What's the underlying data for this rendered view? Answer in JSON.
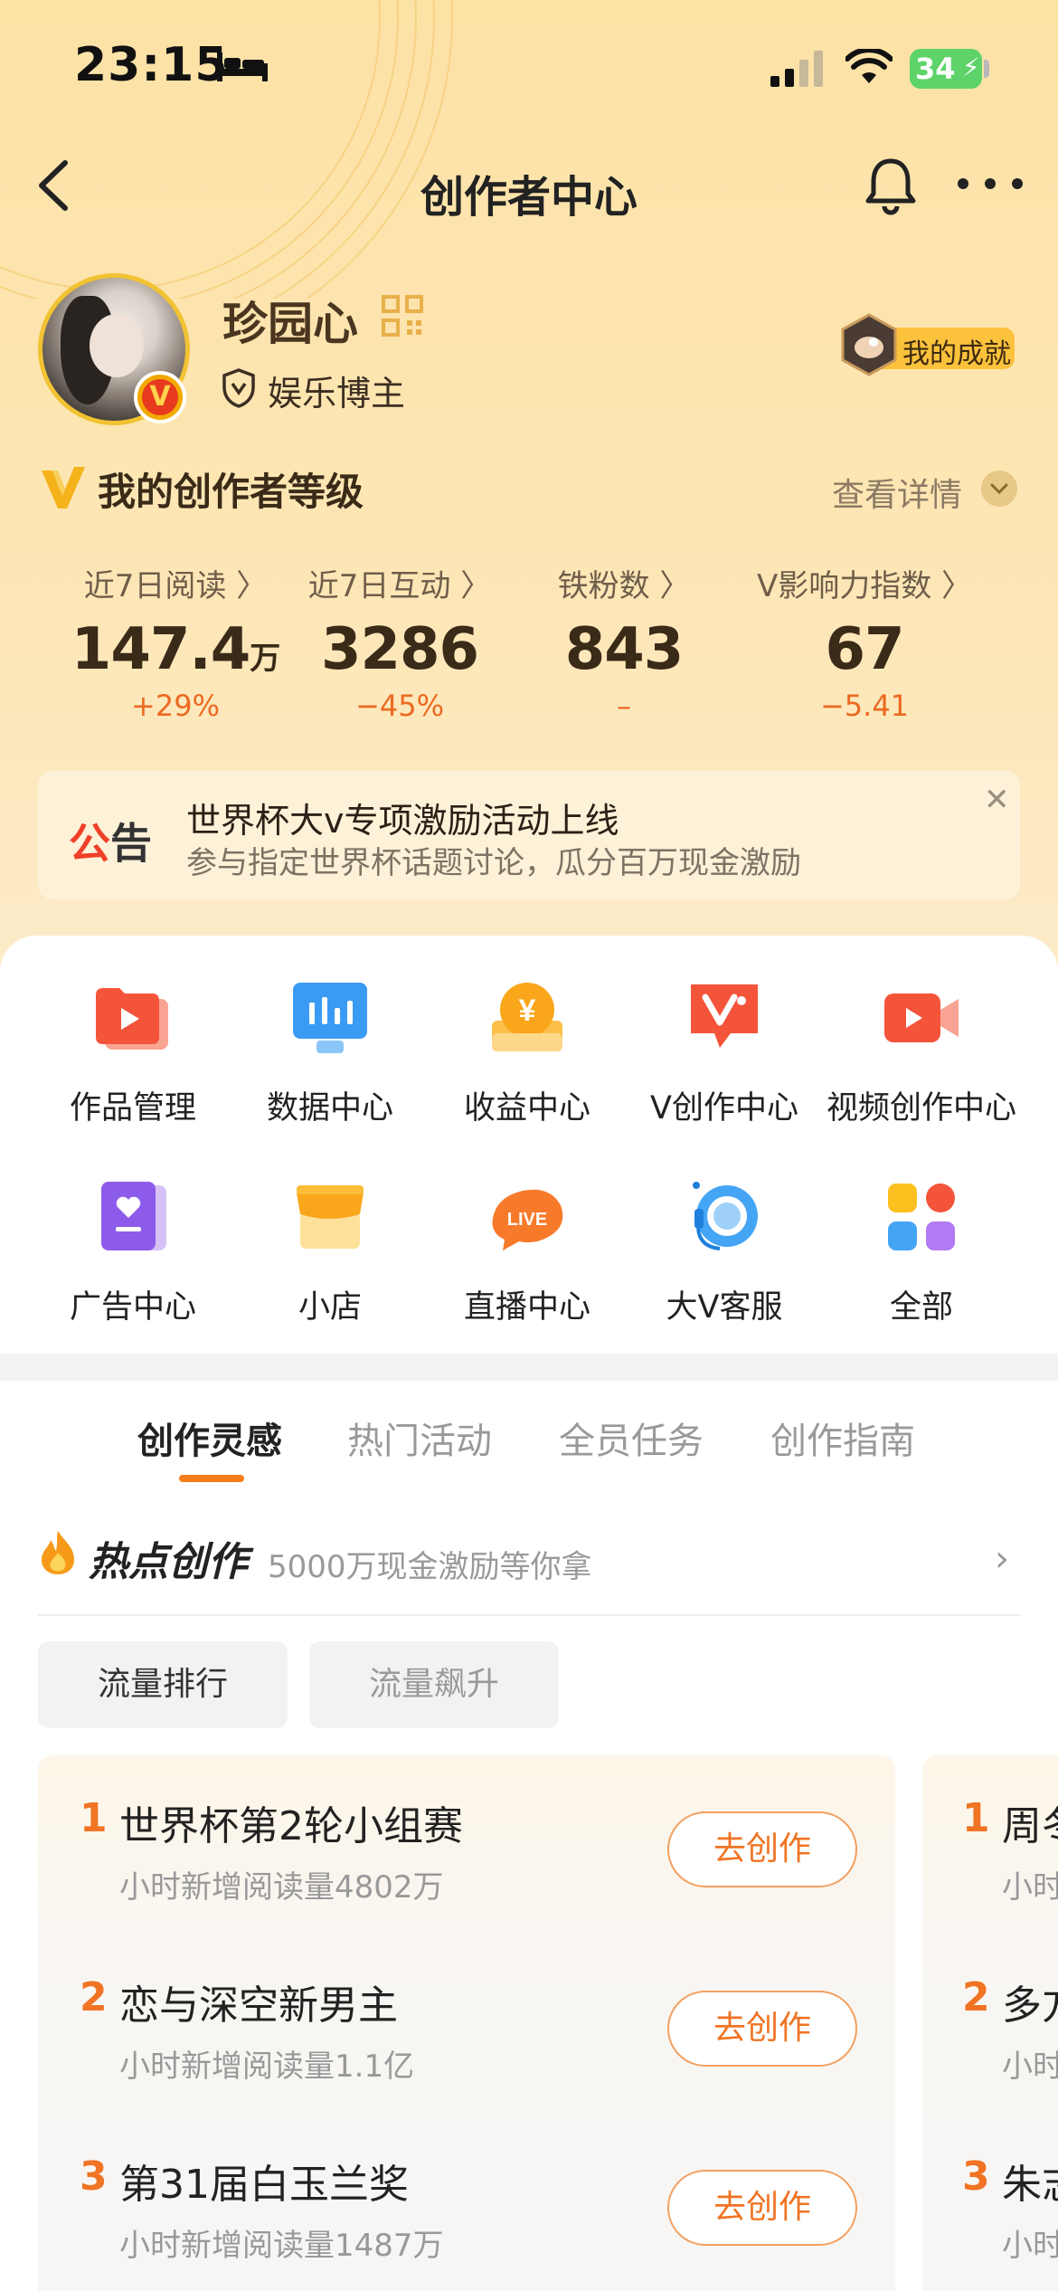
{
  "status_bar": {
    "time": "23:15",
    "battery": "34"
  },
  "nav": {
    "title": "创作者中心"
  },
  "profile": {
    "name": "珍园心",
    "role": "娱乐博主",
    "verified_badge": "V",
    "achievement": "我的成就"
  },
  "level": {
    "title": "我的创作者等级",
    "detail": "查看详情"
  },
  "stats": [
    {
      "label": "近7日阅读 〉",
      "value": "147.4",
      "unit": "万",
      "change": "+29%"
    },
    {
      "label": "近7日互动 〉",
      "value": "3286",
      "unit": "",
      "change": "−45%"
    },
    {
      "label": "铁粉数 〉",
      "value": "843",
      "unit": "",
      "change": "–"
    },
    {
      "label": "V影响力指数 〉",
      "value": "67",
      "unit": "",
      "change": "−5.41"
    }
  ],
  "notice": {
    "tag_a": "公",
    "tag_b": "告",
    "line1": "世界杯大v专项激励活动上线",
    "line2": "参与指定世界杯话题讨论，瓜分百万现金激励"
  },
  "grid": [
    {
      "label": "作品管理",
      "icon": "works-folder-icon"
    },
    {
      "label": "数据中心",
      "icon": "data-chart-icon"
    },
    {
      "label": "收益中心",
      "icon": "yen-coin-icon"
    },
    {
      "label": "V创作中心",
      "icon": "v-create-icon"
    },
    {
      "label": "视频创作中心",
      "icon": "video-camera-icon"
    },
    {
      "label": "广告中心",
      "icon": "ad-book-icon"
    },
    {
      "label": "小店",
      "icon": "shop-icon"
    },
    {
      "label": "直播中心",
      "icon": "live-icon"
    },
    {
      "label": "大V客服",
      "icon": "headset-service-icon"
    },
    {
      "label": "全部",
      "icon": "all-apps-icon"
    }
  ],
  "tabs": [
    "创作灵感",
    "热门活动",
    "全员任务",
    "创作指南"
  ],
  "hot": {
    "title": "热点创作",
    "subtitle": "5000万现金激励等你拿"
  },
  "chips": [
    "流量排行",
    "流量飙升"
  ],
  "rank": [
    {
      "num": "1",
      "title": "世界杯第2轮小组赛",
      "sub": "小时新增阅读量4802万",
      "button": "去创作"
    },
    {
      "num": "2",
      "title": "恋与深空新男主",
      "sub": "小时新增阅读量1.1亿",
      "button": "去创作"
    },
    {
      "num": "3",
      "title": "第31届白玉兰奖",
      "sub": "小时新增阅读量1487万",
      "button": "去创作"
    }
  ],
  "rank2": [
    {
      "num": "1",
      "title": "周冬",
      "sub": "小时"
    },
    {
      "num": "2",
      "title": "多方",
      "sub": "小时"
    },
    {
      "num": "3",
      "title": "朱志",
      "sub": "小时"
    }
  ],
  "colors": {
    "accent": "#f07424",
    "header_bg": "#fde2a6",
    "gold": "#f1c232"
  }
}
